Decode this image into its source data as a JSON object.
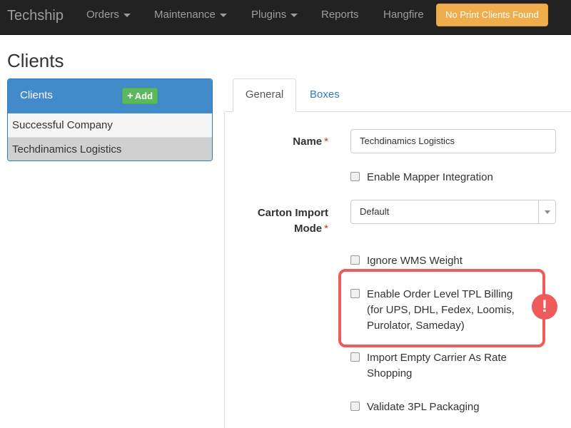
{
  "navbar": {
    "brand": "Techship",
    "items": [
      {
        "label": "Orders",
        "dropdown": true
      },
      {
        "label": "Maintenance",
        "dropdown": true
      },
      {
        "label": "Plugins",
        "dropdown": true
      },
      {
        "label": "Reports",
        "dropdown": false
      },
      {
        "label": "Hangfire",
        "dropdown": false
      }
    ],
    "warning_button": "No Print Clients Found"
  },
  "page_title": "Clients",
  "clients_panel": {
    "title": "Clients",
    "add_button": "Add",
    "items": [
      "Successful Company",
      "Techdinamics Logistics"
    ],
    "selected": "Techdinamics Logistics"
  },
  "tabs": [
    {
      "label": "General",
      "active": true
    },
    {
      "label": "Boxes",
      "active": false
    }
  ],
  "form": {
    "name_label": "Name",
    "required_mark": "*",
    "name_value": "Techdinamics Logistics",
    "carton_import_label_line1": "Carton Import",
    "carton_import_label_line2": "Mode",
    "carton_import_value": "Default",
    "checkboxes": {
      "mapper": "Enable Mapper Integration",
      "ignore_wms": "Ignore WMS Weight",
      "order_tpl_line1": "Enable Order Level TPL Billing",
      "order_tpl_line2": "(for UPS, DHL, Fedex, Loomis,",
      "order_tpl_line3": "Purolator, Sameday)",
      "import_empty_line1": "Import Empty Carrier As Rate",
      "import_empty_line2": "Shopping",
      "validate_3pl": "Validate 3PL Packaging"
    }
  },
  "alert_badge": "!",
  "colors": {
    "navbar_bg": "#222222",
    "warning": "#f0ad4e",
    "panel_heading": "#428bca",
    "add_button": "#5cb85c",
    "highlight": "#ef5a5a",
    "link": "#337ab7"
  }
}
